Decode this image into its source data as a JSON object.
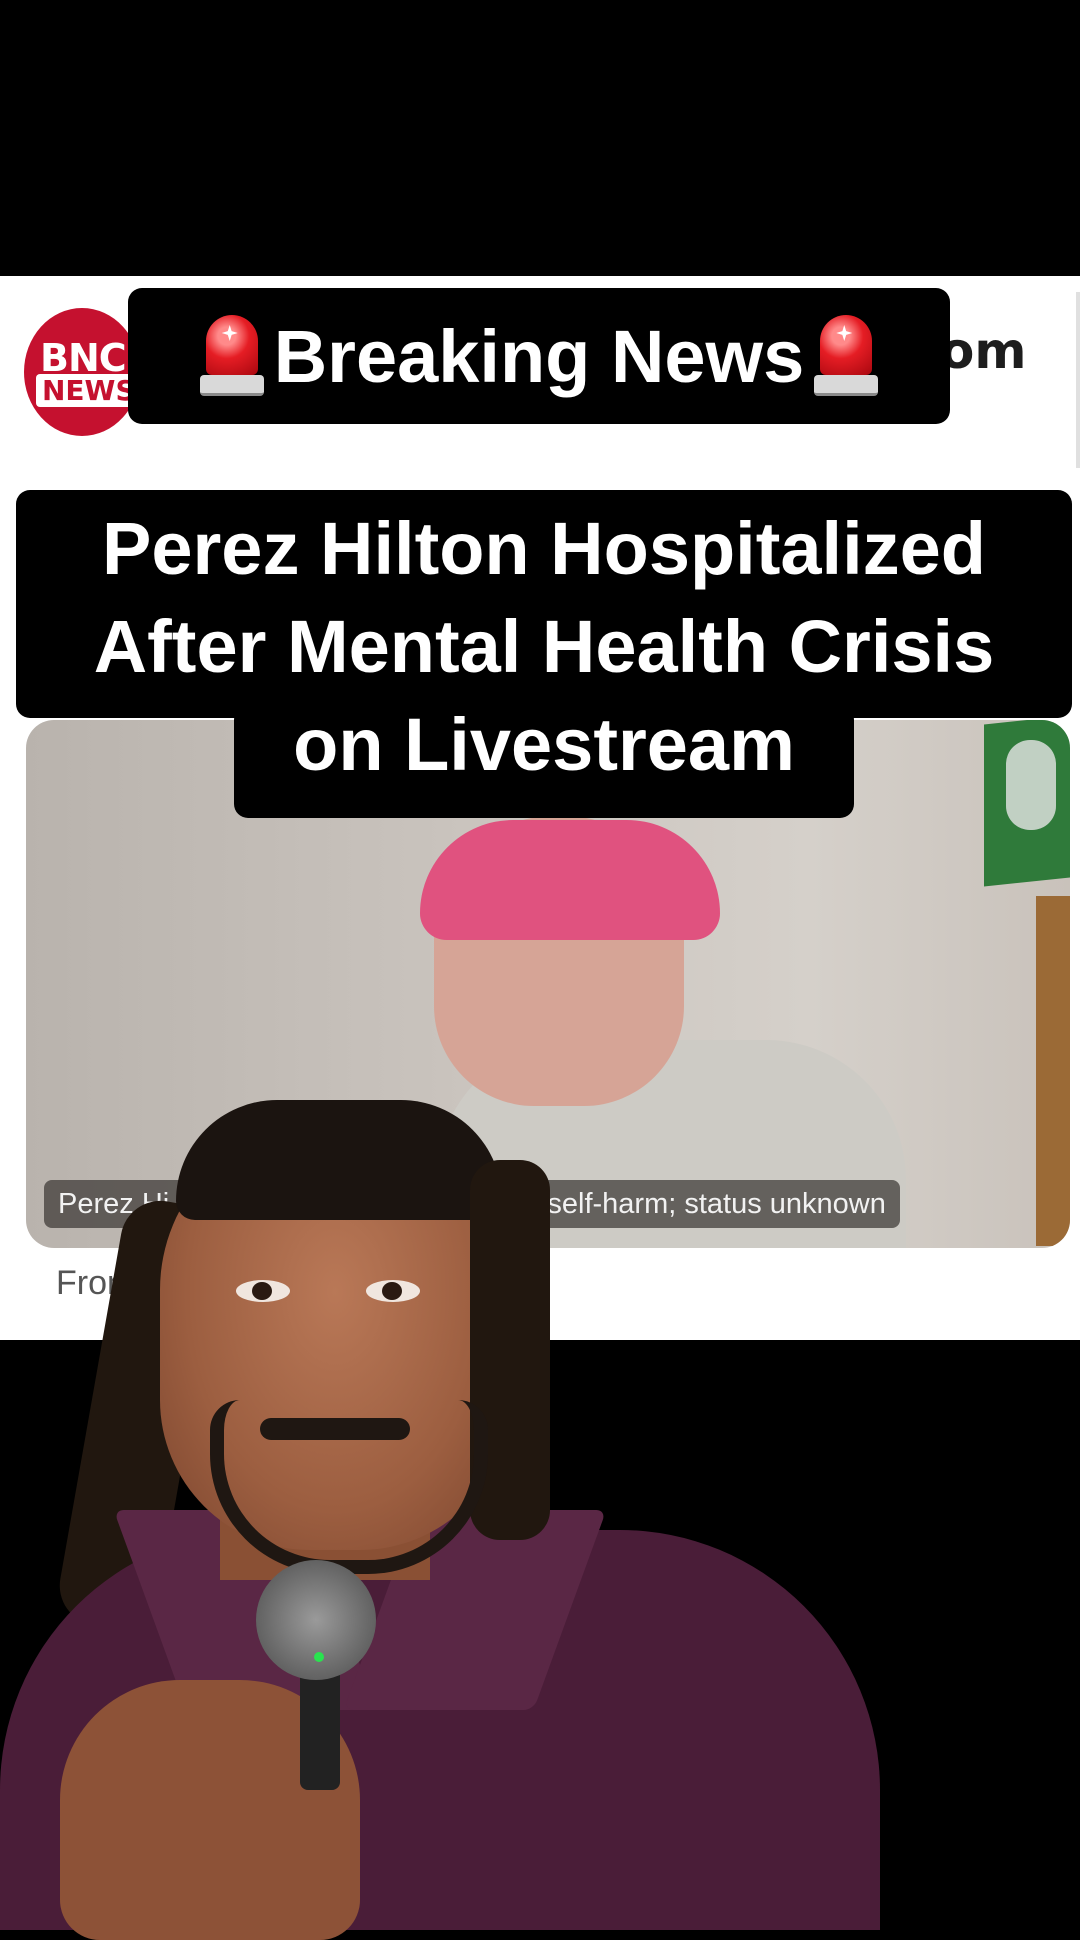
{
  "banner": {
    "text": "Breaking News",
    "icon": "police-car-light-icon"
  },
  "site": {
    "logo_line1": "BNC",
    "logo_line2": "NEWS",
    "domain_fragment": "om"
  },
  "headline": {
    "line1": "Perez Hilton Hospitalized",
    "line2": "After Mental Health Crisis",
    "line3": "on Livestream"
  },
  "video": {
    "caption_left": "Perez Hi",
    "caption_right": "ent self-harm; status unknown"
  },
  "article": {
    "from_fragment": "From h"
  },
  "colors": {
    "brand_red": "#c5112f",
    "background": "#000000",
    "article_bg": "#ffffff"
  }
}
